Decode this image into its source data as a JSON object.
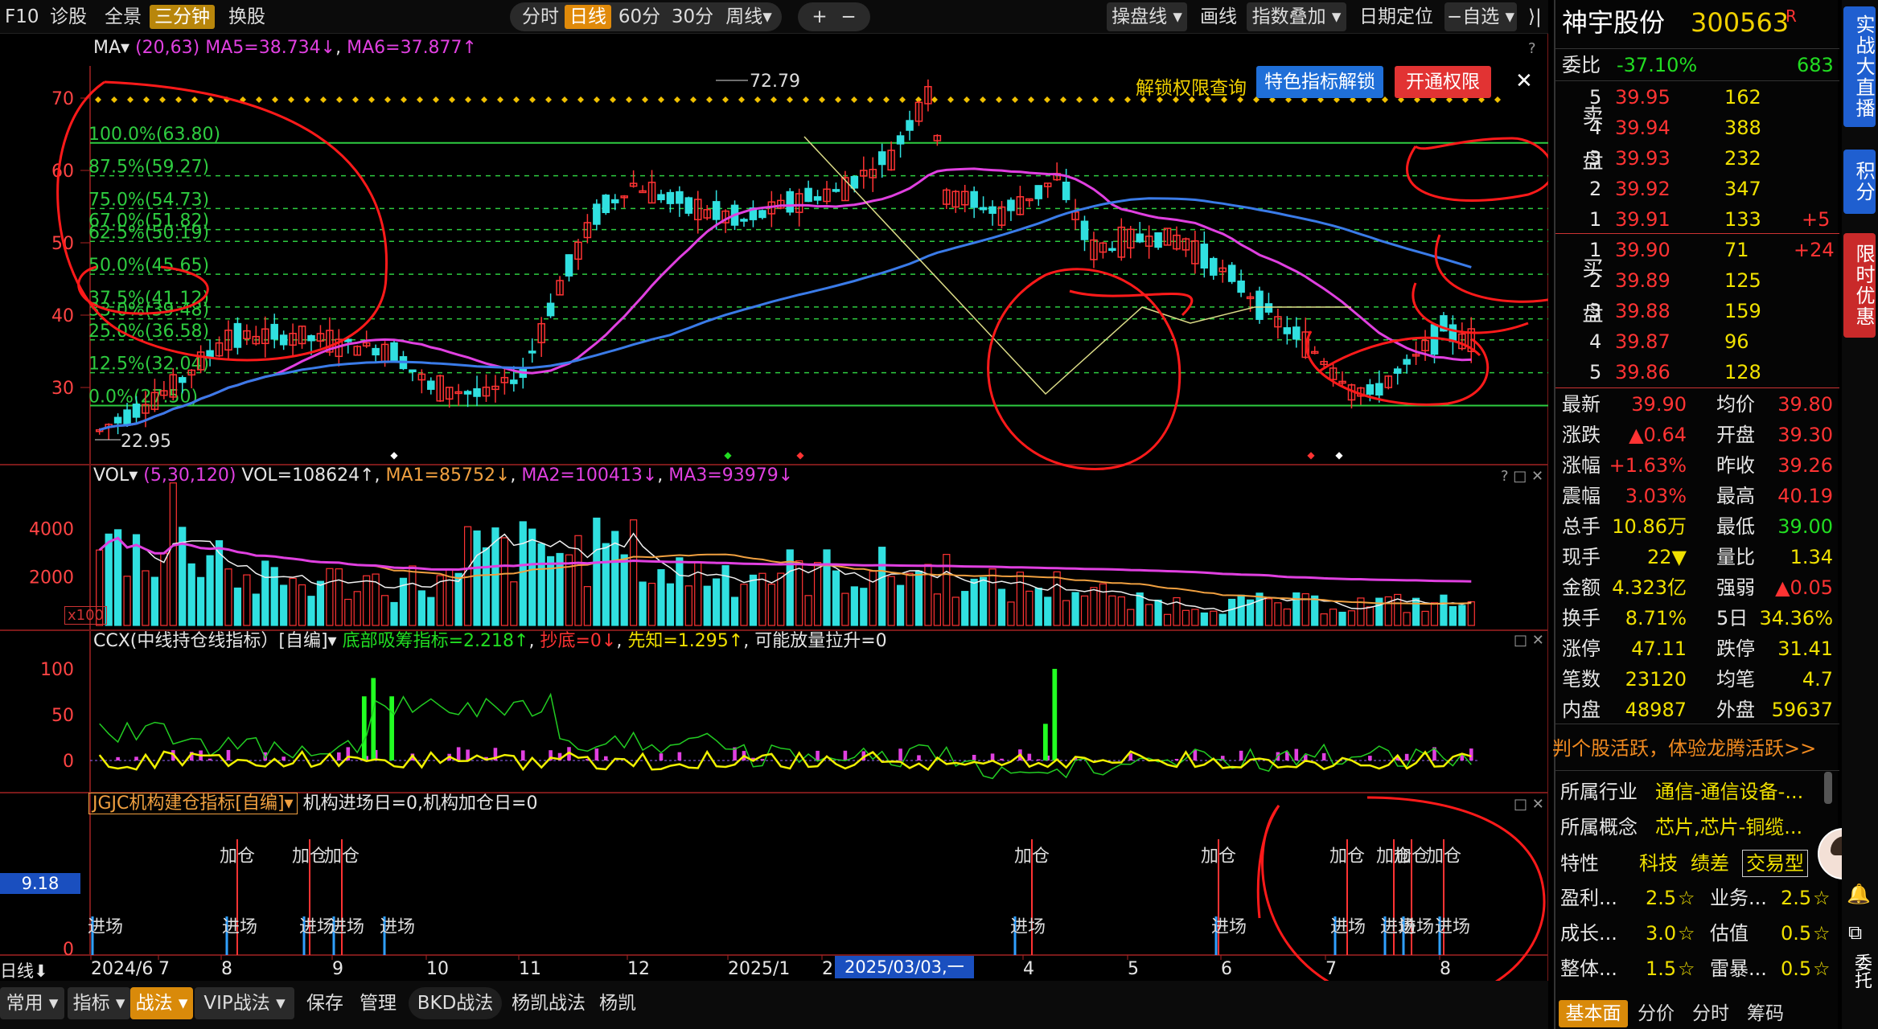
{
  "toolbar": {
    "left": [
      "F10",
      "诊股",
      "全景",
      "三分钟",
      "换股"
    ],
    "periods": [
      "分时",
      "日线",
      "60分",
      "30分",
      "周线▾"
    ],
    "zoom": [
      "+",
      "−"
    ],
    "right": [
      "操盘线 ▾",
      "画线",
      "指数叠加 ▾",
      "日期定位",
      "−自选 ▾"
    ]
  },
  "main_panel": {
    "indicator": "MA▾",
    "params": "(20,63)",
    "ma5": "MA5=38.734↓",
    "ma6": "MA6=37.877↑",
    "help": "?",
    "overlay": {
      "unlock_query": "解锁权限查询",
      "feature_unlock": "特色指标解锁",
      "open_perm": "开通权限",
      "close": "✕"
    },
    "y_ticks": [
      "70",
      "60",
      "50",
      "40",
      "30"
    ],
    "fib_labels": [
      "100.0%(63.80)",
      "87.5%(59.27)",
      "75.0%(54.73)",
      "67.0%(51.82)",
      "62.5%(50.19)",
      "50.0%(45.65)",
      "37.5%(41.12)",
      "33.0%(39.48)",
      "25.0%(36.58)",
      "12.5%(32.04)",
      "0.0%(27.50)"
    ],
    "high_label": "72.79",
    "low_label": "22.95"
  },
  "vol_panel": {
    "indicator": "VOL▾",
    "params": "(5,30,120)",
    "vol": "VOL=108624↑",
    "ma1": "MA1=85752↓",
    "ma2": "MA2=100413↓",
    "ma3": "MA3=93979↓",
    "y_ticks": [
      "4000",
      "2000"
    ],
    "unit": "x100",
    "ctrl": "? □ ✕"
  },
  "ccx_panel": {
    "title": "CCX(中线持仓线指标）[自编]▾",
    "t1": "底部吸筹指标=2.218↑",
    "t2": "抄底=0↓",
    "t3": "先知=1.295↑",
    "t4": "可能放量拉升=0",
    "y_ticks": [
      "100",
      "50",
      "0"
    ],
    "ctrl": "□ ✕"
  },
  "jgjc_panel": {
    "title": "JGJC机构建仓指标[自编]▾",
    "status": "机构进场日=0,机构加仓日=0",
    "value": "9.18",
    "y_tick": "0",
    "ctrl": "□ ✕",
    "add_label": "加仓",
    "entry_label": "进场"
  },
  "x_axis": {
    "left_label": "日线⬇",
    "labels": [
      "2024/6",
      "7",
      "8",
      "9",
      "10",
      "11",
      "12",
      "2025/1",
      "2",
      "4",
      "5",
      "6",
      "7",
      "8"
    ],
    "cursor": "2025/03/03,一"
  },
  "bottombar": [
    "常用 ▾",
    "指标 ▾",
    "战法 ▾",
    "VIP战法 ▾",
    "保存",
    "管理",
    "BKD战法",
    "杨凯战法",
    "杨凯"
  ],
  "stock": {
    "name": "神宇股份",
    "code": "300563",
    "badge": "R"
  },
  "weibi": {
    "label": "委比",
    "value": "-37.10%",
    "diff": "683"
  },
  "asks": [
    {
      "lvl": "5",
      "price": "39.95",
      "vol": "162",
      "chg": ""
    },
    {
      "lvl": "4",
      "price": "39.94",
      "vol": "388",
      "chg": ""
    },
    {
      "lvl": "3",
      "price": "39.93",
      "vol": "232",
      "chg": ""
    },
    {
      "lvl": "2",
      "price": "39.92",
      "vol": "347",
      "chg": ""
    },
    {
      "lvl": "1",
      "price": "39.91",
      "vol": "133",
      "chg": "+5"
    }
  ],
  "bids": [
    {
      "lvl": "1",
      "price": "39.90",
      "vol": "71",
      "chg": "+24"
    },
    {
      "lvl": "2",
      "price": "39.89",
      "vol": "125",
      "chg": ""
    },
    {
      "lvl": "3",
      "price": "39.88",
      "vol": "159",
      "chg": ""
    },
    {
      "lvl": "4",
      "price": "39.87",
      "vol": "96",
      "chg": ""
    },
    {
      "lvl": "5",
      "price": "39.86",
      "vol": "128",
      "chg": ""
    }
  ],
  "side_labels": {
    "sell": "卖盘",
    "buy": "买盘"
  },
  "stats": [
    [
      "最新",
      "39.90",
      "均价",
      "39.80"
    ],
    [
      "涨跌",
      "▲0.64",
      "开盘",
      "39.30"
    ],
    [
      "涨幅",
      "+1.63%",
      "昨收",
      "39.26"
    ],
    [
      "震幅",
      "3.03%",
      "最高",
      "40.19"
    ],
    [
      "总手",
      "10.86万",
      "最低",
      "39.00"
    ],
    [
      "现手",
      "22▼",
      "量比",
      "1.34"
    ],
    [
      "金额",
      "4.323亿",
      "强弱",
      "▲0.05"
    ],
    [
      "换手",
      "8.71%",
      "5日",
      "34.36%"
    ],
    [
      "涨停",
      "47.11",
      "跌停",
      "31.41"
    ],
    [
      "笔数",
      "23120",
      "均笔",
      "4.7"
    ],
    [
      "内盘",
      "48987",
      "外盘",
      "59637"
    ]
  ],
  "promo": "判个股活跃，体验龙腾活跃>>",
  "industry": {
    "label": "所属行业",
    "value": "通信-通信设备-..."
  },
  "concept": {
    "label": "所属概念",
    "value": "芯片,芯片-铜缆..."
  },
  "traits": {
    "label": "特性",
    "t1": "科技",
    "t2": "绩差",
    "t3": "交易型"
  },
  "ratings": [
    [
      "盈利...",
      "2.5",
      "业务...",
      "2.5"
    ],
    [
      "成长...",
      "3.0",
      "估值",
      "0.5"
    ],
    [
      "整体...",
      "1.5",
      "雷暴...",
      "0.5"
    ]
  ],
  "tabs": [
    "基本面",
    "分价",
    "分时",
    "筹码"
  ],
  "side": [
    "实战大直播",
    "积分",
    "限时优惠"
  ],
  "colors": {
    "up": "#ff3333",
    "down": "#30e0e0",
    "ma_pink": "#e040e0",
    "ma_blue": "#3a7be8",
    "fib": "#2ecc40",
    "accent": "#e08a0a"
  }
}
